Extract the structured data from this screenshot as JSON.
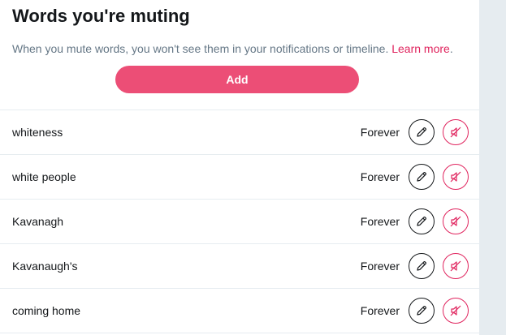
{
  "header": {
    "title": "Words you're muting",
    "description": "When you mute words, you won't see them in your notifications or timeline.",
    "learn_more": "Learn more",
    "period": ".",
    "add_label": "Add"
  },
  "colors": {
    "accent": "#e0245e",
    "button": "#ec4e76",
    "text": "#14171a",
    "secondary_text": "#657786"
  },
  "icons": {
    "edit": "pencil-icon",
    "unmute": "speaker-off-icon"
  },
  "muted_words": [
    {
      "word": "whiteness",
      "duration": "Forever"
    },
    {
      "word": "white people",
      "duration": "Forever"
    },
    {
      "word": "Kavanagh",
      "duration": "Forever"
    },
    {
      "word": "Kavanaugh's",
      "duration": "Forever"
    },
    {
      "word": "coming home",
      "duration": "Forever"
    }
  ]
}
